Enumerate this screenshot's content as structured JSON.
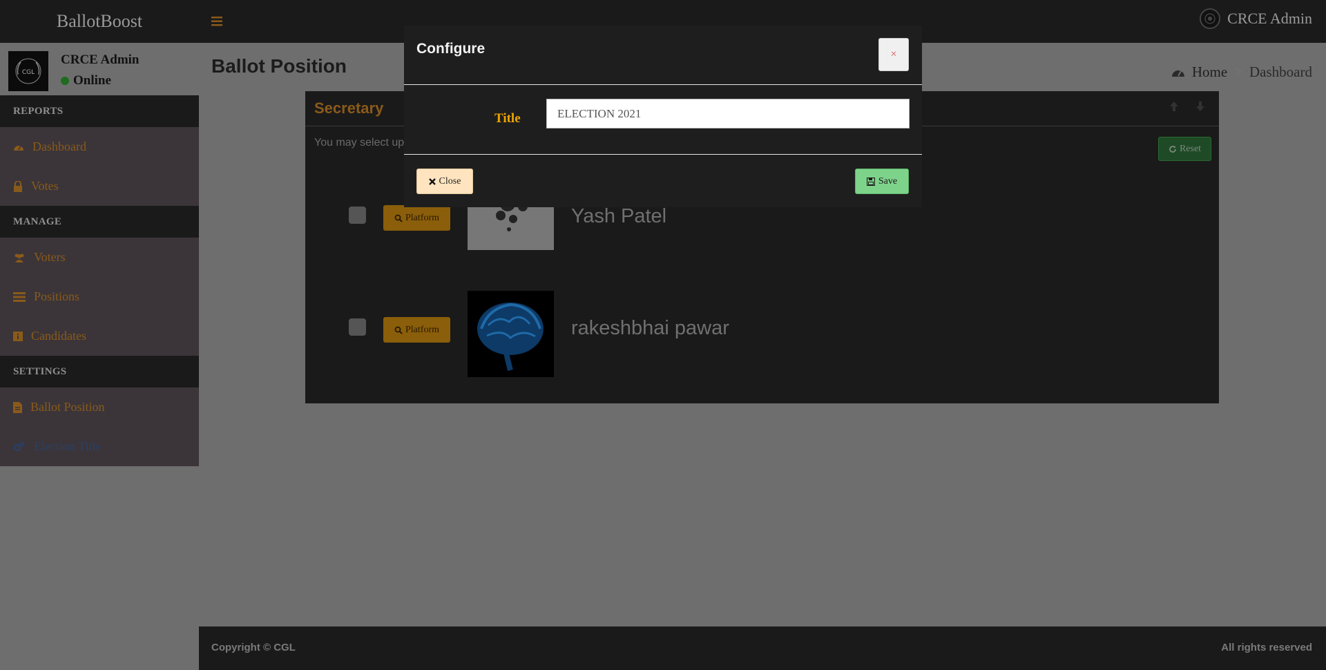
{
  "app": {
    "brand": "BallotBoost",
    "top_user_name": "CRCE Admin"
  },
  "sidebar": {
    "user": {
      "name": "CRCE Admin",
      "status": "Online",
      "avatar_text": "CGL"
    },
    "sections": [
      {
        "header": "REPORTS",
        "items": [
          {
            "label": "Dashboard",
            "icon": "dashboard-icon"
          },
          {
            "label": "Votes",
            "icon": "lock-icon"
          }
        ]
      },
      {
        "header": "MANAGE",
        "items": [
          {
            "label": "Voters",
            "icon": "users-icon"
          },
          {
            "label": "Positions",
            "icon": "list-icon"
          },
          {
            "label": "Candidates",
            "icon": "id-card-icon"
          }
        ]
      },
      {
        "header": "SETTINGS",
        "items": [
          {
            "label": "Ballot Position",
            "icon": "file-icon"
          },
          {
            "label": "Election Title",
            "icon": "cogs-icon"
          }
        ]
      }
    ]
  },
  "content": {
    "page_title": "Ballot Position",
    "breadcrumb": {
      "home": "Home",
      "current": "Dashboard"
    },
    "position_box": {
      "title": "Secretary",
      "instruction": "You may select up",
      "reset_label": "Reset",
      "candidates": [
        {
          "name": "Yash Patel",
          "platform_label": "Platform"
        },
        {
          "name": "rakeshbhai pawar",
          "platform_label": "Platform"
        }
      ]
    }
  },
  "modal": {
    "title": "Configure",
    "close_x": "×",
    "field_label": "Title",
    "field_value": "ELECTION 2021",
    "close_label": "Close",
    "save_label": "Save"
  },
  "footer": {
    "left": "Copyright © CGL",
    "right": "All rights reserved"
  },
  "colors": {
    "accent_orange": "#f0a500",
    "dark_bg": "#1a1a1a",
    "save_green": "#7ed38b",
    "close_peach": "#ffe4bf"
  }
}
